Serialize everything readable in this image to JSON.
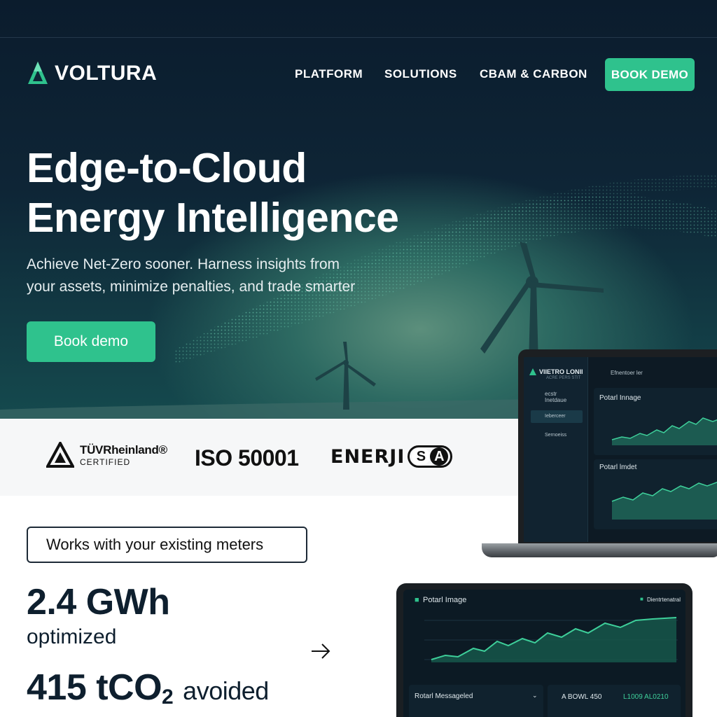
{
  "brand": {
    "name": "VOLTURA"
  },
  "nav": {
    "items": [
      "PLATFORM",
      "SOLUTIONS",
      "CBAM & CARBON"
    ],
    "cta": "BOOK DEMO"
  },
  "hero": {
    "headline_line1": "Edge-to-Cloud",
    "headline_line2": "Energy Intelligence",
    "subhead_line1": "Achieve Net-Zero sooner. Harness insights from",
    "subhead_line2": "your assets, minimize penalties, and trade smarter",
    "cta": "Book demo"
  },
  "partners": {
    "tuv_name": "TÜVRheinland®",
    "tuv_sub": "CERTIFIED",
    "iso": "ISO 50001",
    "enerji_word": "ENERJI",
    "enerji_s": "S",
    "enerji_a": "A"
  },
  "badge": "Works with your existing meters",
  "stats": {
    "energy_value": "2.4 GWh",
    "energy_label": "optimized",
    "carbon_value": "415 tCO",
    "carbon_sub": "2",
    "carbon_label": "avoided"
  },
  "laptop": {
    "app_title": "VIIETRO LONII",
    "app_sub": "ACRE PERS STIT",
    "side_item1_line1": "ecstr",
    "side_item1_line2": "Inetdaue",
    "side_item2": "Ieberceer",
    "side_item3": "Sernoeiss",
    "header_label": "Efnentoer ler",
    "panel1_title": "Potarl Innage",
    "panel2_title": "Potarl lmdet"
  },
  "tablet": {
    "title": "Potarl Image",
    "right_label": "Dientrtenatral",
    "bottom_left": "Rotarl Messageled",
    "bottom_mid": "A BOWL 450",
    "bottom_right": "L1009 AL0210"
  },
  "colors": {
    "accent": "#2fc28d",
    "hero_dark": "#0b1c2d",
    "chart_line": "#3ecf9a"
  },
  "icons": [
    "voltura-logo-icon",
    "tuv-triangle-icon",
    "arrow-right-icon"
  ]
}
